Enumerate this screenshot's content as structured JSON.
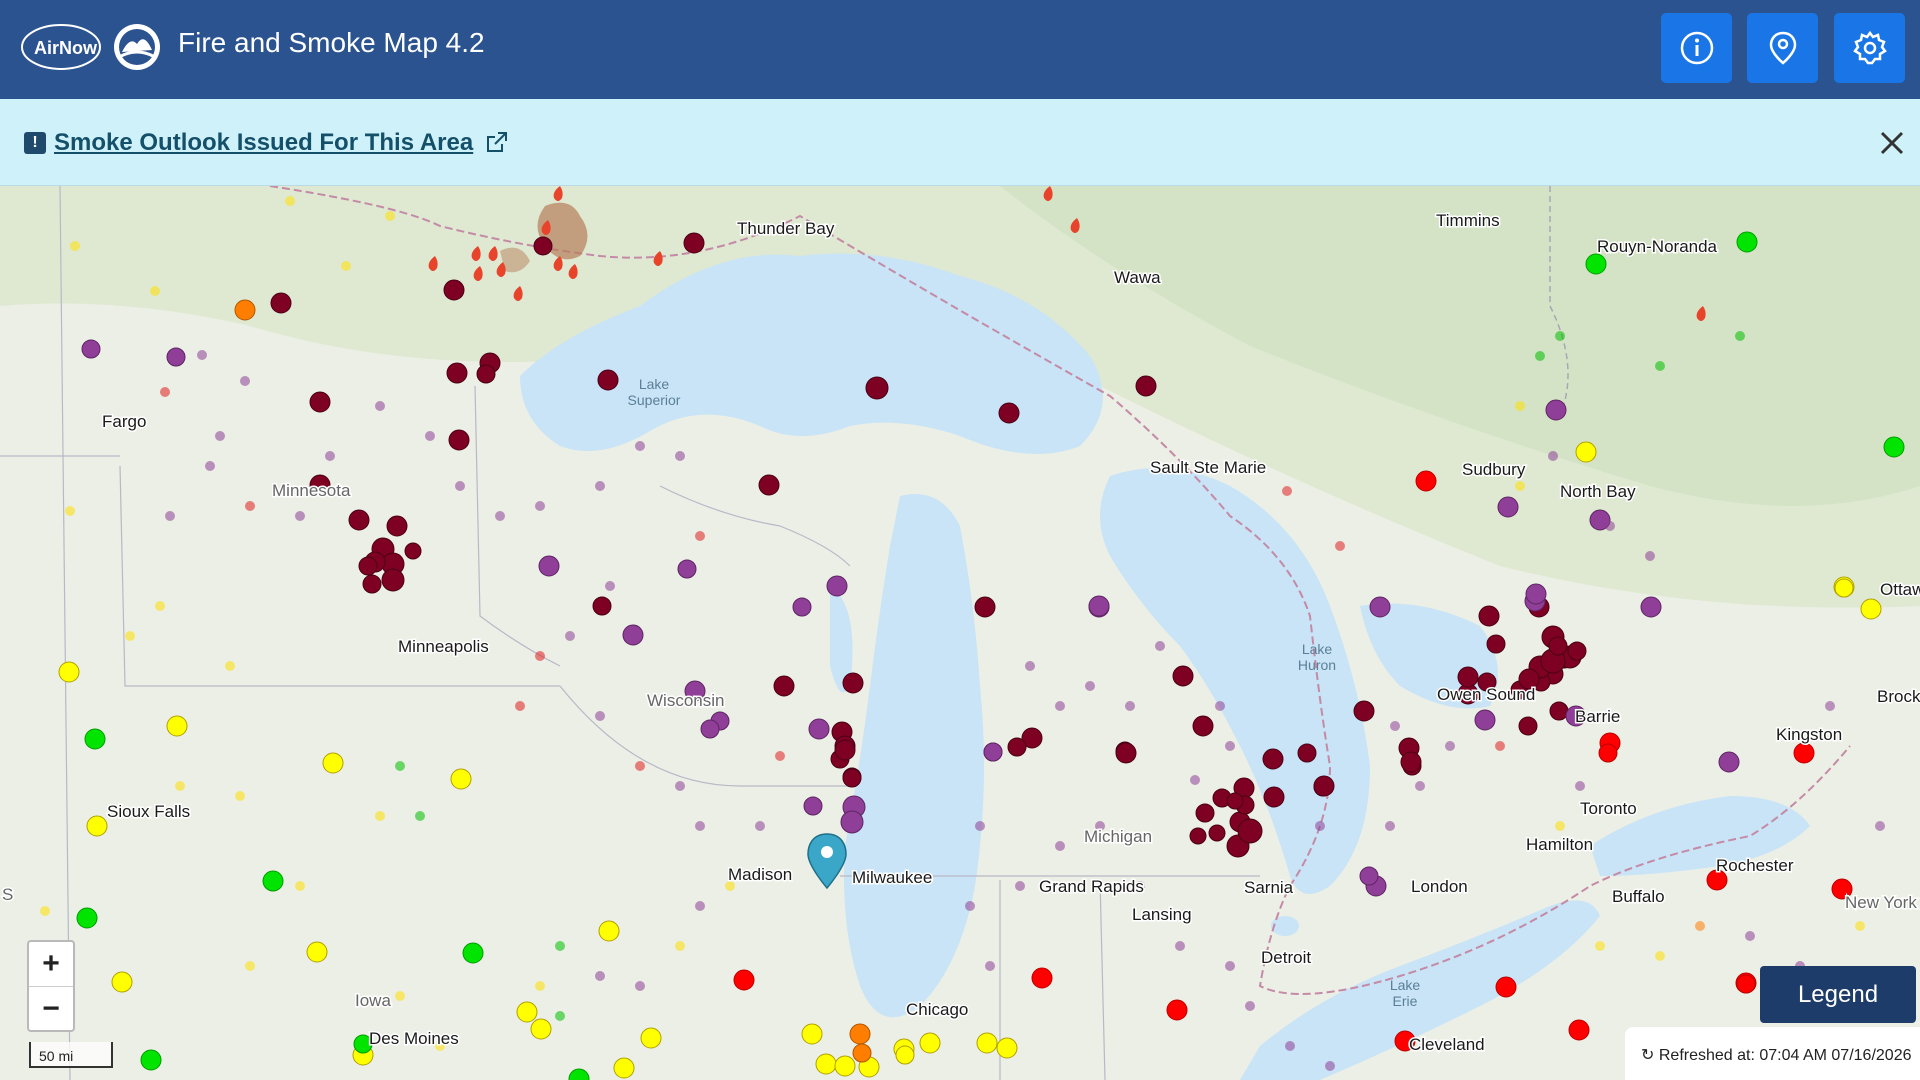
{
  "header": {
    "logo_text": "AirNow",
    "title": "Fire and Smoke Map 4.2",
    "buttons": [
      {
        "name": "info-icon"
      },
      {
        "name": "location-pin-icon"
      },
      {
        "name": "gear-icon"
      }
    ]
  },
  "banner": {
    "badge": "!",
    "link_text": "Smoke Outlook Issued For This Area",
    "ext_icon": "external-link-icon",
    "close_icon": "close-icon"
  },
  "map": {
    "cities": [
      {
        "name": "Thunder Bay"
      },
      {
        "name": "Timmins"
      },
      {
        "name": "Rouyn-Noranda"
      },
      {
        "name": "Wawa"
      },
      {
        "name": "Fargo"
      },
      {
        "name": "Minnesota"
      },
      {
        "name": "Sault Ste Marie"
      },
      {
        "name": "Sudbury"
      },
      {
        "name": "North Bay"
      },
      {
        "name": "Ottaw"
      },
      {
        "name": "Minneapolis"
      },
      {
        "name": "Wisconsin"
      },
      {
        "name": "Owen Sound"
      },
      {
        "name": "Brock"
      },
      {
        "name": "Barrie"
      },
      {
        "name": "Kingston"
      },
      {
        "name": "Toronto"
      },
      {
        "name": "Sioux Falls"
      },
      {
        "name": "Michigan"
      },
      {
        "name": "Hamilton"
      },
      {
        "name": "Rochester"
      },
      {
        "name": "Madison"
      },
      {
        "name": "Milwaukee"
      },
      {
        "name": "Grand Rapids"
      },
      {
        "name": "Sarnia"
      },
      {
        "name": "London"
      },
      {
        "name": "Buffalo"
      },
      {
        "name": "New York"
      },
      {
        "name": "Lansing"
      },
      {
        "name": "Detroit"
      },
      {
        "name": "Iowa"
      },
      {
        "name": "Chicago"
      },
      {
        "name": "Des Moines"
      },
      {
        "name": "Cleveland"
      },
      {
        "name": "S"
      }
    ],
    "lakes": [
      {
        "name": "Lake\nSuperior"
      },
      {
        "name": "Lake\nHuron"
      },
      {
        "name": "Lake\nErie"
      }
    ],
    "zoom_in": "+",
    "zoom_out": "−",
    "scale": "50 mi"
  },
  "legend_button": "Legend",
  "refresh_text": "Refreshed at: 07:04 AM 07/16/2026",
  "colors": {
    "header_bg": "#2b5390",
    "button_bg": "#1a76e6",
    "banner_bg": "#cff2fa",
    "aqi_good": "#00e400",
    "aqi_moderate": "#ffff00",
    "aqi_usg": "#ff7e00",
    "aqi_unhealthy": "#ff0000",
    "aqi_very_unhealthy": "#8f3f97",
    "aqi_hazardous": "#7e0023"
  }
}
